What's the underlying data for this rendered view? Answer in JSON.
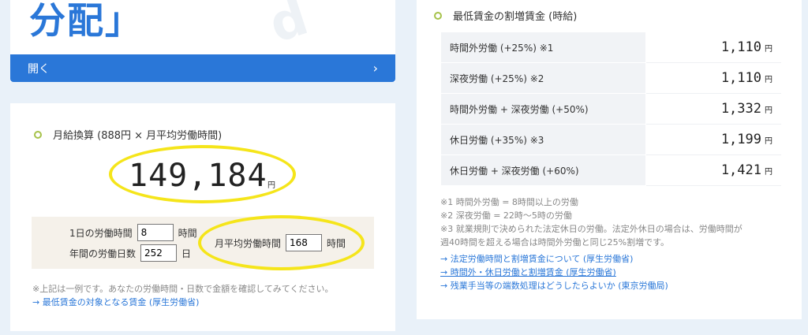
{
  "banner": {
    "title": "分配」",
    "open_label": "開く",
    "chevron": "›"
  },
  "monthly": {
    "heading": "月給換算 (888円 × 月平均労働時間)",
    "result": "149,184",
    "unit": "円",
    "daily_hours_label": "1日の労働時間",
    "daily_hours_value": "8",
    "daily_hours_unit": "時間",
    "annual_days_label": "年間の労働日数",
    "annual_days_value": "252",
    "annual_days_unit": "日",
    "monthly_hours_label": "月平均労働時間",
    "monthly_hours_value": "168",
    "monthly_hours_unit": "時間",
    "note": "※上記は一例です。あなたの労働時間・日数で金額を確認してみてください。",
    "link": "→ 最低賃金の対象となる賃金 (厚生労働省)"
  },
  "rates": {
    "heading": "最低賃金の割増賃金 (時給)",
    "unit": "円",
    "rows": [
      {
        "label": "時間外労働 (+25%) ※1",
        "value": "1,110"
      },
      {
        "label": "深夜労働 (+25%) ※2",
        "value": "1,110"
      },
      {
        "label": "時間外労働 + 深夜労働 (+50%)",
        "value": "1,332"
      },
      {
        "label": "休日労働 (+35%) ※3",
        "value": "1,199"
      },
      {
        "label": "休日労働 + 深夜労働 (+60%)",
        "value": "1,421"
      }
    ],
    "footnotes": [
      "※1 時間外労働 = 8時間以上の労働",
      "※2 深夜労働 = 22時～5時の労働",
      "※3 就業規則で決められた法定休日の労働。法定外休日の場合は、労働時間が",
      "週40時間を超える場合は時間外労働と同じ25%割増です。"
    ],
    "links": [
      "→ 法定労働時間と割増賃金について (厚生労働省)",
      "→ 時間外・休日労働と割増賃金 (厚生労働省)",
      "→ 残業手当等の端数処理はどうしたらよいか (東京労働局)"
    ]
  },
  "colors": {
    "accent": "#2a77d8",
    "bullet": "#a6c24a",
    "highlight": "#f5e51a"
  }
}
